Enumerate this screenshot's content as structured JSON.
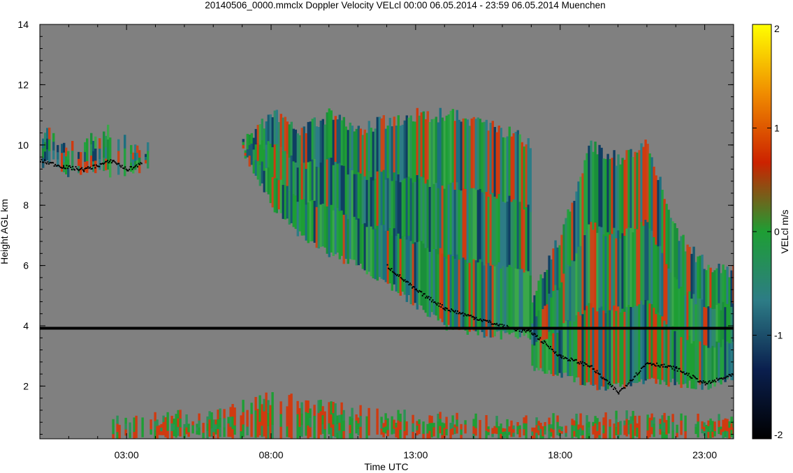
{
  "chart_data": {
    "type": "heatmap",
    "title": "20140506_0000.mmclx Doppler Velocity VELcl   00:00 06.05.2014 - 23:59 06.05.2014 Muenchen",
    "xlabel": "Time UTC",
    "ylabel": "Height AGL km",
    "x_tick_labels": [
      "03:00",
      "08:00",
      "13:00",
      "18:00",
      "23:00"
    ],
    "x_tick_hours": [
      3,
      8,
      13,
      18,
      23
    ],
    "xlim_hours": [
      0,
      24
    ],
    "y_tick_labels": [
      "2",
      "4",
      "6",
      "8",
      "10",
      "12",
      "14"
    ],
    "y_ticks": [
      2,
      4,
      6,
      8,
      10,
      12,
      14
    ],
    "ylim_km": [
      0.25,
      14
    ],
    "background_color": "#808080",
    "colorbar": {
      "label": "VELcl m/s",
      "tick_labels": [
        "2",
        "1",
        "0",
        "-1",
        "-2"
      ],
      "ticks": [
        2,
        1,
        0,
        -1,
        -2
      ],
      "range": [
        -2,
        2
      ],
      "stops": [
        "#000000",
        "#0a1f4e",
        "#2d7c86",
        "#1e9e34",
        "#cc2200",
        "#f08c00",
        "#ffff00"
      ]
    },
    "cloud_regions": [
      {
        "name": "cirrus-early",
        "hours": [
          0.0,
          0.4,
          0.8,
          1.3,
          2.0,
          2.5,
          3.0,
          3.4,
          3.7
        ],
        "top_km": [
          10.3,
          10.4,
          10.0,
          9.9,
          10.4,
          10.5,
          10.0,
          9.9,
          9.9
        ],
        "base_km": [
          9.3,
          9.5,
          9.1,
          9.0,
          9.2,
          9.0,
          9.1,
          9.2,
          9.3
        ]
      },
      {
        "name": "main-cloud",
        "hours": [
          7.0,
          8.0,
          9.0,
          10.0,
          11.0,
          12.0,
          13.0,
          14.0,
          15.0,
          16.0,
          17.0
        ],
        "top_km": [
          10.0,
          11.0,
          10.5,
          11.0,
          10.5,
          10.8,
          11.0,
          11.0,
          10.8,
          10.5,
          10.0
        ],
        "base_km": [
          9.8,
          8.0,
          7.0,
          6.4,
          6.0,
          5.4,
          4.7,
          4.0,
          3.8,
          3.7,
          3.7
        ]
      },
      {
        "name": "late-cloud",
        "hours": [
          17.0,
          18.0,
          19.0,
          20.0,
          21.0,
          22.0,
          23.0,
          24.0
        ],
        "top_km": [
          5.0,
          7.0,
          10.0,
          9.5,
          10.0,
          7.0,
          6.0,
          5.8
        ],
        "base_km": [
          2.6,
          2.4,
          2.0,
          2.0,
          2.2,
          2.1,
          2.0,
          2.3
        ]
      },
      {
        "name": "boundary-layer-clutter",
        "hours": [
          2.5,
          6.0,
          8.0,
          12.0,
          16.0,
          20.0,
          24.0
        ],
        "top_km": [
          0.9,
          1.0,
          1.6,
          1.0,
          0.8,
          1.0,
          0.8
        ],
        "base_km": [
          0.3,
          0.3,
          0.3,
          0.3,
          0.3,
          0.3,
          0.3
        ]
      }
    ],
    "line_4km_km": 3.92,
    "cloud_base_trace": {
      "hours": [
        0.0,
        0.8,
        1.5,
        2.5,
        3.0,
        3.5,
        12.0,
        13.0,
        14.0,
        15.0,
        16.0,
        17.0,
        18.0,
        19.0,
        20.0,
        21.0,
        22.0,
        23.0,
        24.0
      ],
      "km": [
        9.5,
        9.3,
        9.2,
        9.5,
        9.2,
        9.4,
        6.0,
        5.2,
        4.6,
        4.3,
        4.0,
        3.8,
        3.0,
        2.7,
        1.8,
        2.8,
        2.6,
        2.1,
        2.4
      ]
    }
  }
}
